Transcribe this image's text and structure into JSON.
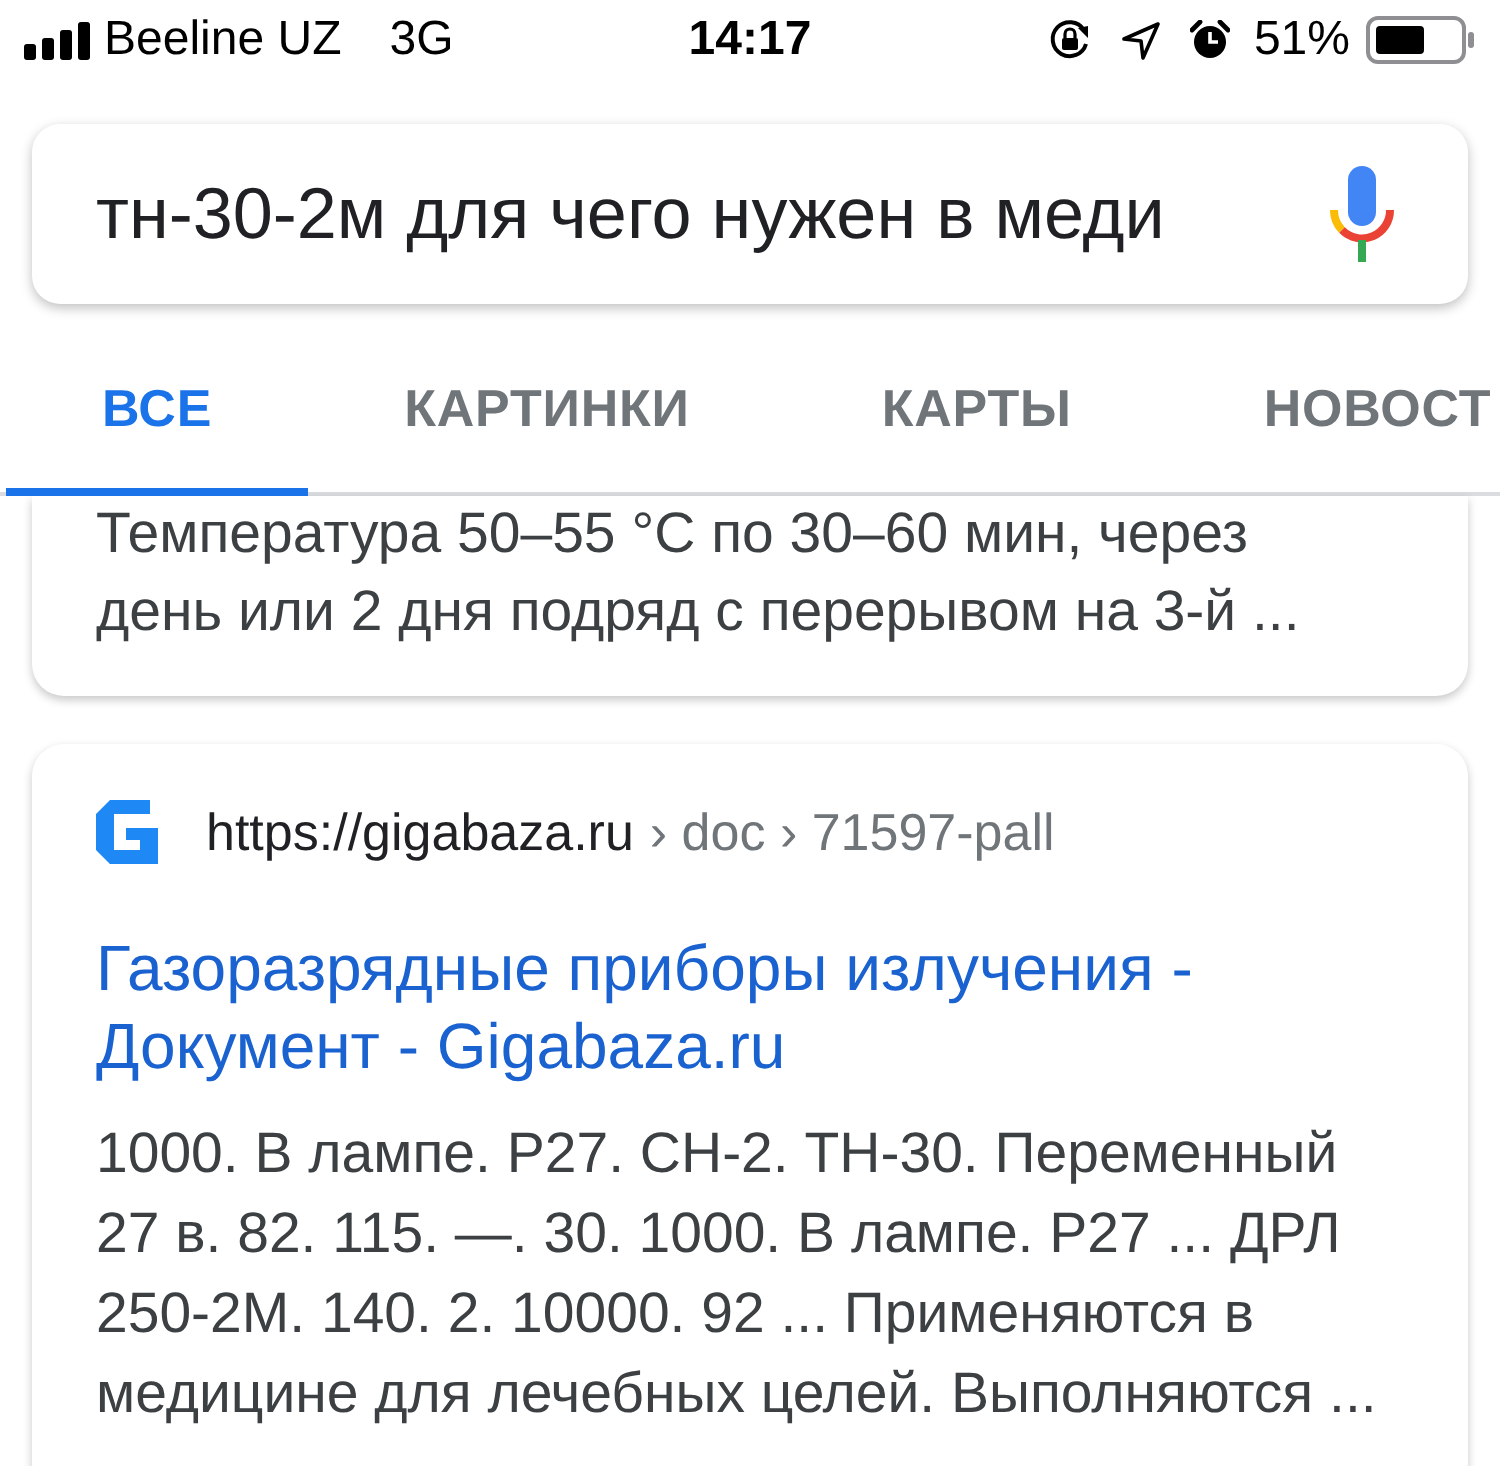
{
  "status_bar": {
    "carrier": "Beeline UZ",
    "network": "3G",
    "time": "14:17",
    "battery": "51%"
  },
  "search": {
    "value": "тн-30-2м для чего нужен в меди"
  },
  "tabs": [
    {
      "label": "ВСЕ",
      "selected": true
    },
    {
      "label": "КАРТИНКИ",
      "selected": false
    },
    {
      "label": "КАРТЫ",
      "selected": false
    },
    {
      "label": "НОВОСТ",
      "selected": false
    }
  ],
  "results": [
    {
      "kind": "snippet_only",
      "snippet": "Температура 50–55 °C по 30–60 мин, через день или 2 дня подряд с перерывом на 3-й ..."
    },
    {
      "kind": "full",
      "url": "https://gigabaza.ru",
      "path": "› doc › 71597-pall",
      "title": "Газоразрядные приборы излучения - Документ - Gigabaza.ru",
      "snippet": "1000. В лампе. Р27. СН-2. ТН-30. Переменный 27 в. 82. 115. —. 30. 1000. В лампе. Р27 ... ДРЛ 250-2М. 140. 2. 10000. 92 ... Применяются в медицине для лечебных целей. Выполняются ..."
    }
  ]
}
